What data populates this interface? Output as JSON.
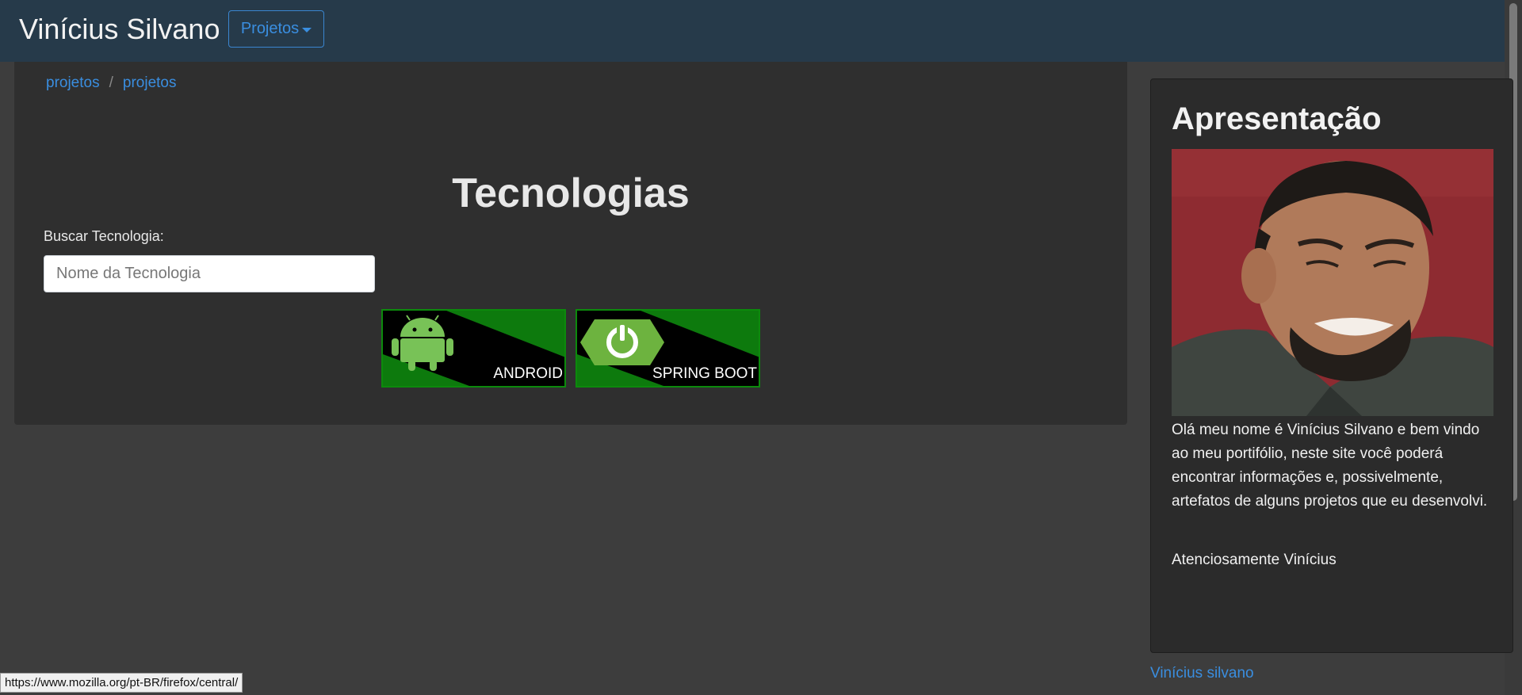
{
  "navbar": {
    "brand": "Vinícius Silvano",
    "dropdown_label": "Projetos"
  },
  "breadcrumb": [
    "projetos",
    "projetos"
  ],
  "main": {
    "title": "Tecnologias",
    "search_label": "Buscar Tecnologia:",
    "search_placeholder": "Nome da Tecnologia",
    "search_value": "",
    "technologies": [
      {
        "label": "ANDROID",
        "icon": "android-icon"
      },
      {
        "label": "SPRING BOOT",
        "icon": "spring-boot-icon"
      }
    ]
  },
  "sidebar": {
    "title": "Apresentação",
    "photo": "profile-photo",
    "text": "Olá meu nome é Vinícius Silvano e bem vindo ao meu portifólio, neste site você poderá encontrar informações e, possivelmente, artefatos de alguns projetos que eu desenvolvi.",
    "signature": "Atenciosamente Vinícius"
  },
  "footer": {
    "link": "Vinícius silvano"
  },
  "status_bar": {
    "url": "https://www.mozilla.org/pt-BR/firefox/central/"
  },
  "colors": {
    "navbar": "#263a4a",
    "accent": "#3a8ee0",
    "card_green": "#0d7a0d",
    "panel": "#2f2f2f"
  }
}
